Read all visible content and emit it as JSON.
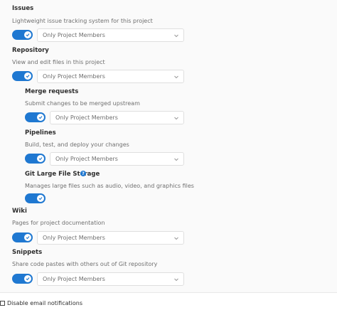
{
  "colors": {
    "accent": "#1f78d1",
    "heading": "#2e2e2e",
    "description": "#707070",
    "panel_bg": "#fafafa"
  },
  "icons": {
    "toggle_check": "check-icon",
    "dropdown": "chevron-down-icon",
    "help": "question-circle-icon"
  },
  "settings": {
    "issues": {
      "title": "Issues",
      "description": "Lightweight issue tracking system for this project",
      "enabled": true,
      "access": "Only Project Members"
    },
    "repository": {
      "title": "Repository",
      "description": "View and edit files in this project",
      "enabled": true,
      "access": "Only Project Members"
    },
    "merge_requests": {
      "title": "Merge requests",
      "description": "Submit changes to be merged upstream",
      "enabled": true,
      "access": "Only Project Members"
    },
    "pipelines": {
      "title": "Pipelines",
      "description": "Build, test, and deploy your changes",
      "enabled": true,
      "access": "Only Project Members"
    },
    "lfs": {
      "title": "Git Large File Storage",
      "help_glyph": "?",
      "description": "Manages large files such as audio, video, and graphics files",
      "enabled": true
    },
    "wiki": {
      "title": "Wiki",
      "description": "Pages for project documentation",
      "enabled": true,
      "access": "Only Project Members"
    },
    "snippets": {
      "title": "Snippets",
      "description": "Share code pastes with others out of Git repository",
      "enabled": true,
      "access": "Only Project Members"
    }
  },
  "footer": {
    "disable_email_label": "Disable email notifications",
    "disable_email_checked": false
  }
}
